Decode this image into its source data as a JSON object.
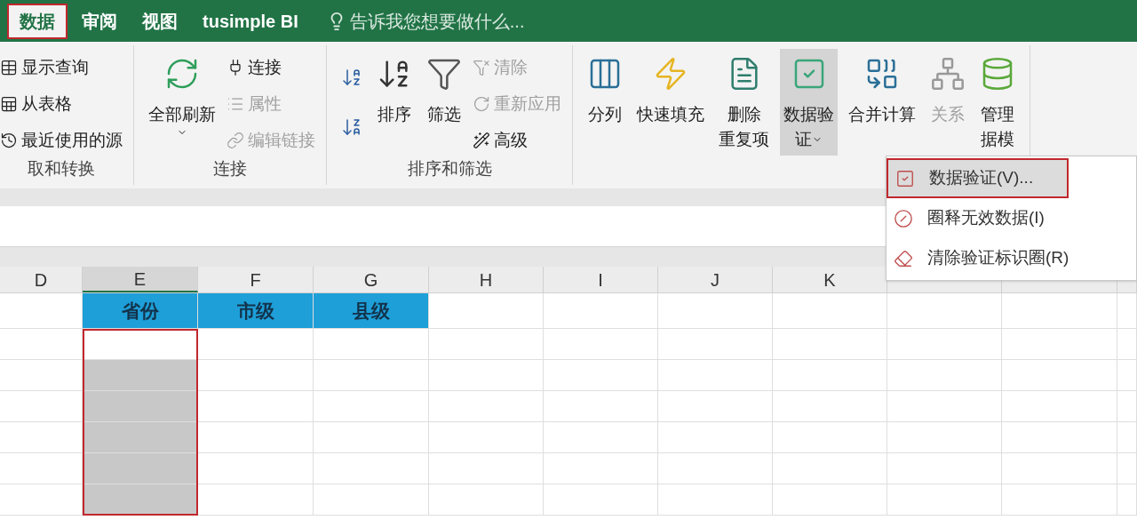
{
  "tabs": [
    {
      "label": "数据",
      "selected": true,
      "outlined": true
    },
    {
      "label": "审阅",
      "selected": false,
      "outlined": false
    },
    {
      "label": "视图",
      "selected": false,
      "outlined": false
    },
    {
      "label": "tusimple BI",
      "selected": false,
      "outlined": false
    }
  ],
  "tell_me": {
    "placeholder": "告诉我您想要做什么..."
  },
  "ribbon_groups": [
    {
      "label": "取和转换",
      "items": [
        {
          "kind": "stack",
          "items": [
            {
              "label": "显示查询",
              "disabled": false
            },
            {
              "label": "从表格",
              "disabled": false
            },
            {
              "label": "最近使用的源",
              "disabled": false
            }
          ]
        }
      ]
    },
    {
      "label": "连接",
      "items": [
        {
          "kind": "large",
          "lines": [
            "全部刷新"
          ],
          "dropdown": true,
          "expanded": false,
          "disabled": false
        },
        {
          "kind": "stack",
          "items": [
            {
              "label": "连接",
              "disabled": false
            },
            {
              "label": "属性",
              "disabled": true
            },
            {
              "label": "编辑链接",
              "disabled": true
            }
          ]
        }
      ]
    },
    {
      "label": "排序和筛选",
      "items": [
        {
          "kind": "sort",
          "items": [
            {
              "kind": "ascending"
            },
            {
              "kind": "descending"
            }
          ]
        },
        {
          "kind": "large",
          "lines": [
            "排序"
          ],
          "dropdown": false,
          "expanded": false,
          "disabled": false
        },
        {
          "kind": "large",
          "lines": [
            "筛选"
          ],
          "dropdown": false,
          "expanded": false,
          "disabled": false
        },
        {
          "kind": "stack",
          "items": [
            {
              "label": "清除",
              "disabled": true
            },
            {
              "label": "重新应用",
              "disabled": true
            },
            {
              "label": "高级",
              "disabled": false
            }
          ]
        }
      ]
    },
    {
      "items": [
        {
          "kind": "large",
          "lines": [
            "分列"
          ],
          "dropdown": false,
          "expanded": false,
          "disabled": false
        },
        {
          "kind": "large",
          "lines": [
            "快速填充"
          ],
          "dropdown": false,
          "expanded": false,
          "disabled": false
        },
        {
          "kind": "large",
          "lines": [
            "删除",
            "重复项"
          ],
          "dropdown": false,
          "expanded": false,
          "disabled": false
        },
        {
          "kind": "large",
          "lines": [
            "数据验",
            "证"
          ],
          "dropdown": true,
          "expanded": true,
          "disabled": false
        },
        {
          "kind": "large",
          "lines": [
            "合并计算"
          ],
          "dropdown": false,
          "expanded": false,
          "disabled": false
        },
        {
          "kind": "large",
          "lines": [
            "关系"
          ],
          "dropdown": false,
          "expanded": false,
          "disabled": true
        },
        {
          "kind": "large",
          "lines": [
            "管理",
            "据模"
          ],
          "dropdown": false,
          "expanded": false,
          "disabled": false
        }
      ]
    }
  ],
  "menu": {
    "items": [
      {
        "label": "数据验证(V)...",
        "selected": true,
        "outlined": true
      },
      {
        "label": "圈释无效数据(I)",
        "selected": false,
        "outlined": false
      },
      {
        "label": "清除验证标识圈(R)",
        "selected": false,
        "outlined": false
      }
    ]
  },
  "grid": {
    "columns": [
      {
        "label": "D",
        "selected": false
      },
      {
        "label": "E",
        "selected": true
      },
      {
        "label": "F",
        "selected": false
      },
      {
        "label": "G",
        "selected": false
      },
      {
        "label": "H",
        "selected": false
      },
      {
        "label": "I",
        "selected": false
      },
      {
        "label": "J",
        "selected": false
      },
      {
        "label": "K",
        "selected": false
      }
    ],
    "range_outlined": true,
    "rows": [
      {
        "cells": [
          {
            "kind": "empty"
          },
          {
            "kind": "heading",
            "text": "省份"
          },
          {
            "kind": "heading",
            "text": "市级"
          },
          {
            "kind": "heading",
            "text": "县级"
          },
          {
            "kind": "empty"
          },
          {
            "kind": "empty"
          },
          {
            "kind": "empty"
          },
          {
            "kind": "empty"
          }
        ]
      },
      {
        "cells": [
          {
            "kind": "empty"
          },
          {
            "kind": "active"
          },
          {
            "kind": "empty"
          },
          {
            "kind": "empty"
          },
          {
            "kind": "empty"
          },
          {
            "kind": "empty"
          },
          {
            "kind": "empty"
          },
          {
            "kind": "empty"
          }
        ]
      },
      {
        "cells": [
          {
            "kind": "empty"
          },
          {
            "kind": "selected"
          },
          {
            "kind": "empty"
          },
          {
            "kind": "empty"
          },
          {
            "kind": "empty"
          },
          {
            "kind": "empty"
          },
          {
            "kind": "empty"
          },
          {
            "kind": "empty"
          }
        ]
      },
      {
        "cells": [
          {
            "kind": "empty"
          },
          {
            "kind": "selected"
          },
          {
            "kind": "empty"
          },
          {
            "kind": "empty"
          },
          {
            "kind": "empty"
          },
          {
            "kind": "empty"
          },
          {
            "kind": "empty"
          },
          {
            "kind": "empty"
          }
        ]
      },
      {
        "cells": [
          {
            "kind": "empty"
          },
          {
            "kind": "selected"
          },
          {
            "kind": "empty"
          },
          {
            "kind": "empty"
          },
          {
            "kind": "empty"
          },
          {
            "kind": "empty"
          },
          {
            "kind": "empty"
          },
          {
            "kind": "empty"
          }
        ]
      },
      {
        "cells": [
          {
            "kind": "empty"
          },
          {
            "kind": "selected"
          },
          {
            "kind": "empty"
          },
          {
            "kind": "empty"
          },
          {
            "kind": "empty"
          },
          {
            "kind": "empty"
          },
          {
            "kind": "empty"
          },
          {
            "kind": "empty"
          }
        ]
      },
      {
        "cells": [
          {
            "kind": "empty"
          },
          {
            "kind": "selected"
          },
          {
            "kind": "empty"
          },
          {
            "kind": "empty"
          },
          {
            "kind": "empty"
          },
          {
            "kind": "empty"
          },
          {
            "kind": "empty"
          },
          {
            "kind": "empty"
          }
        ]
      }
    ]
  }
}
